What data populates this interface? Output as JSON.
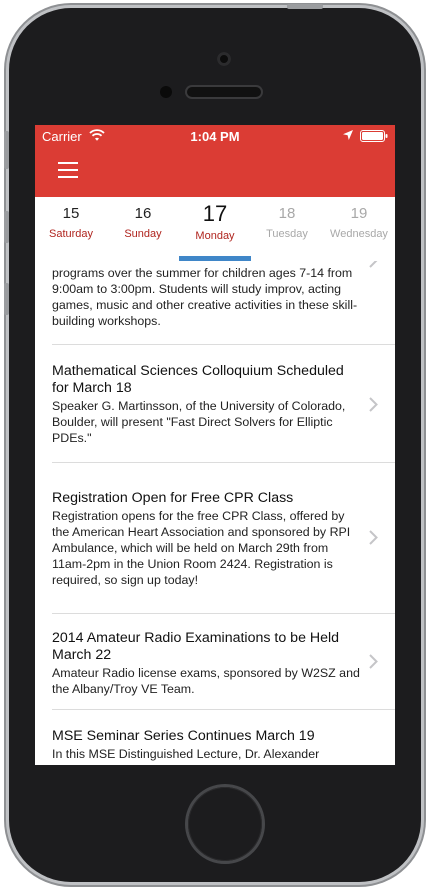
{
  "status_bar": {
    "carrier": "Carrier",
    "time": "1:04 PM",
    "wifi_icon": "wifi-icon",
    "location_icon": "location-arrow-icon",
    "battery_icon": "battery-icon"
  },
  "nav": {
    "menu_icon": "hamburger-menu-icon",
    "accent_color": "#db3c34"
  },
  "dates": [
    {
      "number": "15",
      "day": "Saturday",
      "state": "past"
    },
    {
      "number": "16",
      "day": "Sunday",
      "state": "past"
    },
    {
      "number": "17",
      "day": "Monday",
      "state": "selected"
    },
    {
      "number": "18",
      "day": "Tuesday",
      "state": "future"
    },
    {
      "number": "19",
      "day": "Wednesday",
      "state": "future"
    }
  ],
  "events": [
    {
      "title": "",
      "body": "programs over the summer for children ages 7-14 from 9:00am to 3:00pm. Students will study improv, acting games, music and other creative activities in these skill-building workshops."
    },
    {
      "title": "Mathematical Sciences Colloquium Scheduled for March 18",
      "body": "Speaker G. Martinsson, of the University of Colorado, Boulder, will present \"Fast Direct Solvers for Elliptic PDEs.\""
    },
    {
      "title": "Registration Open for Free CPR Class",
      "body": "Registration opens for the free CPR Class, offered by the American Heart Association and sponsored by RPI Ambulance, which will be held on March 29th from 11am-2pm in the Union Room 2424. Registration is required, so sign up today!"
    },
    {
      "title": "2014 Amateur Radio Examinations to be Held March 22",
      "body": "Amateur Radio license exams, sponsored by W2SZ and the Albany/Troy VE Team."
    },
    {
      "title": "MSE Seminar Series Continues March 19",
      "body": "In this MSE Distinguished Lecture, Dr. Alexander"
    }
  ]
}
